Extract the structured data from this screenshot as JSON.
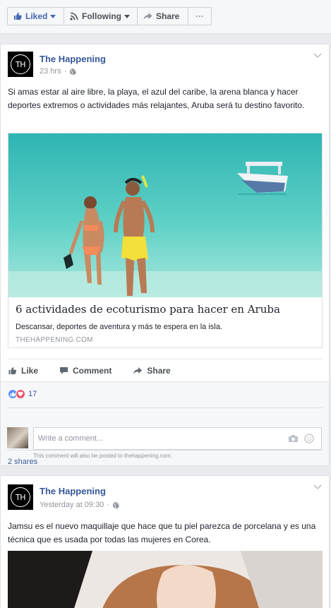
{
  "topbar": {
    "liked": "Liked",
    "following": "Following",
    "share": "Share",
    "more": "···"
  },
  "posts": [
    {
      "page_name": "The Happening",
      "avatar_text": "TH",
      "time": "23 hrs",
      "text": "Si amas estar al aire libre, la playa, el azul del caribe, la arena blanca y hacer deportes extremos o actividades más relajantes, Aruba será tu destino favorito.",
      "link": {
        "title": "6 actividades de ecoturismo para hacer en Aruba",
        "description": "Descansar, deportes de aventura y más te espera en la isla.",
        "domain": "THEHAPPENING.COM"
      },
      "actions": {
        "like": "Like",
        "comment": "Comment",
        "share": "Share"
      },
      "reactions_count": "17",
      "shares": "2 shares",
      "comment_placeholder": "Write a comment...",
      "comment_note": "This comment will also be posted to thehappening.com."
    },
    {
      "page_name": "The Happening",
      "avatar_text": "TH",
      "time": "Yesterday at 09:30",
      "text": "Jamsu es el nuevo maquillaje que hace que tu piel parezca de porcelana y es una técnica que es usada por todas las mujeres en Corea."
    }
  ],
  "colors": {
    "link_blue": "#365899",
    "liked_blue": "#4267b2",
    "background": "#e9ebee"
  }
}
